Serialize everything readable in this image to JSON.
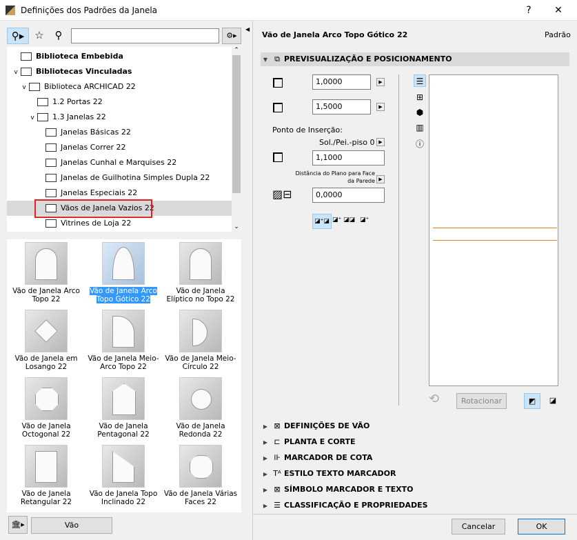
{
  "window": {
    "title": "Definições dos Padrões da Janela",
    "help": "?",
    "close": "✕"
  },
  "left": {
    "search_placeholder": "",
    "tree": [
      {
        "label": "Biblioteca Embebida",
        "bold": true,
        "indent": 0,
        "chev": "",
        "icon": "library-file"
      },
      {
        "label": "Bibliotecas Vinculadas",
        "bold": true,
        "indent": 0,
        "chev": "⌄",
        "icon": "library-folder"
      },
      {
        "label": "Biblioteca ARCHICAD 22",
        "indent": 1,
        "chev": "⌄",
        "icon": "folder"
      },
      {
        "label": "1.2 Portas 22",
        "indent": 2,
        "chev": "",
        "icon": "folder"
      },
      {
        "label": "1.3 Janelas 22",
        "indent": 2,
        "chev": "⌄",
        "icon": "folder"
      },
      {
        "label": "Janelas Básicas 22",
        "indent": 3,
        "chev": "",
        "icon": "folder"
      },
      {
        "label": "Janelas Correr 22",
        "indent": 3,
        "chev": "",
        "icon": "folder"
      },
      {
        "label": "Janelas Cunhal e Marquises 22",
        "indent": 3,
        "chev": "",
        "icon": "folder"
      },
      {
        "label": "Janelas de Guilhotina Simples Dupla 22",
        "indent": 3,
        "chev": "",
        "icon": "folder"
      },
      {
        "label": "Janelas Especiais 22",
        "indent": 3,
        "chev": "",
        "icon": "folder"
      },
      {
        "label": "Vãos de Janela Vazios 22",
        "indent": 3,
        "chev": "",
        "icon": "folder",
        "selected": true
      },
      {
        "label": "Vitrines de Loja 22",
        "indent": 3,
        "chev": "",
        "icon": "folder"
      }
    ],
    "objects": [
      {
        "label": "Vão de Janela Arco Topo 22",
        "shape": "arch"
      },
      {
        "label": "Vão de Janela Arco Topo Gótico 22",
        "shape": "gothic",
        "selected": true
      },
      {
        "label": "Vão de Janela Elíptico no Topo 22",
        "shape": "arch"
      },
      {
        "label": "Vão de Janela em Losango 22",
        "shape": "diamond"
      },
      {
        "label": "Vão de Janela Meio-Arco Topo 22",
        "shape": "halfarch"
      },
      {
        "label": "Vão de Janela Meio-Círculo 22",
        "shape": "halfcircle"
      },
      {
        "label": "Vão de Janela Octogonal 22",
        "shape": "octagon"
      },
      {
        "label": "Vão de Janela Pentagonal 22",
        "shape": "pentagon"
      },
      {
        "label": "Vão de Janela Redonda 22",
        "shape": "circle"
      },
      {
        "label": "Vão de Janela Retangular 22",
        "shape": "rect"
      },
      {
        "label": "Vão de Janela Topo Inclinado 22",
        "shape": "slope"
      },
      {
        "label": "Vão de Janela Várias Faces 22",
        "shape": "polygon"
      }
    ],
    "bottom_button": "Vão"
  },
  "right": {
    "object_name": "Vão de Janela Arco Topo Gótico 22",
    "preset": "Padrão",
    "preview_section": "PREVISUALIZAÇÃO E POSICIONAMENTO",
    "width": "1,0000",
    "height": "1,5000",
    "insertion_label": "Ponto de Inserção:",
    "insertion_ref": "Sol./Pei.-piso 0",
    "sill": "1,1000",
    "plane_label": "Distância do Plano para Face da Parede",
    "plane_value": "0,0000",
    "rotate": "Rotacionar",
    "line_color": "#f07f1a",
    "sections": [
      "DEFINIÇÕES DE VÃO",
      "PLANTA E CORTE",
      "MARCADOR DE COTA",
      "ESTILO TEXTO MARCADOR",
      "SÍMBOLO MARCADOR E TEXTO",
      "CLASSIFICAÇÃO E PROPRIEDADES"
    ],
    "cancel": "Cancelar",
    "ok": "OK"
  }
}
